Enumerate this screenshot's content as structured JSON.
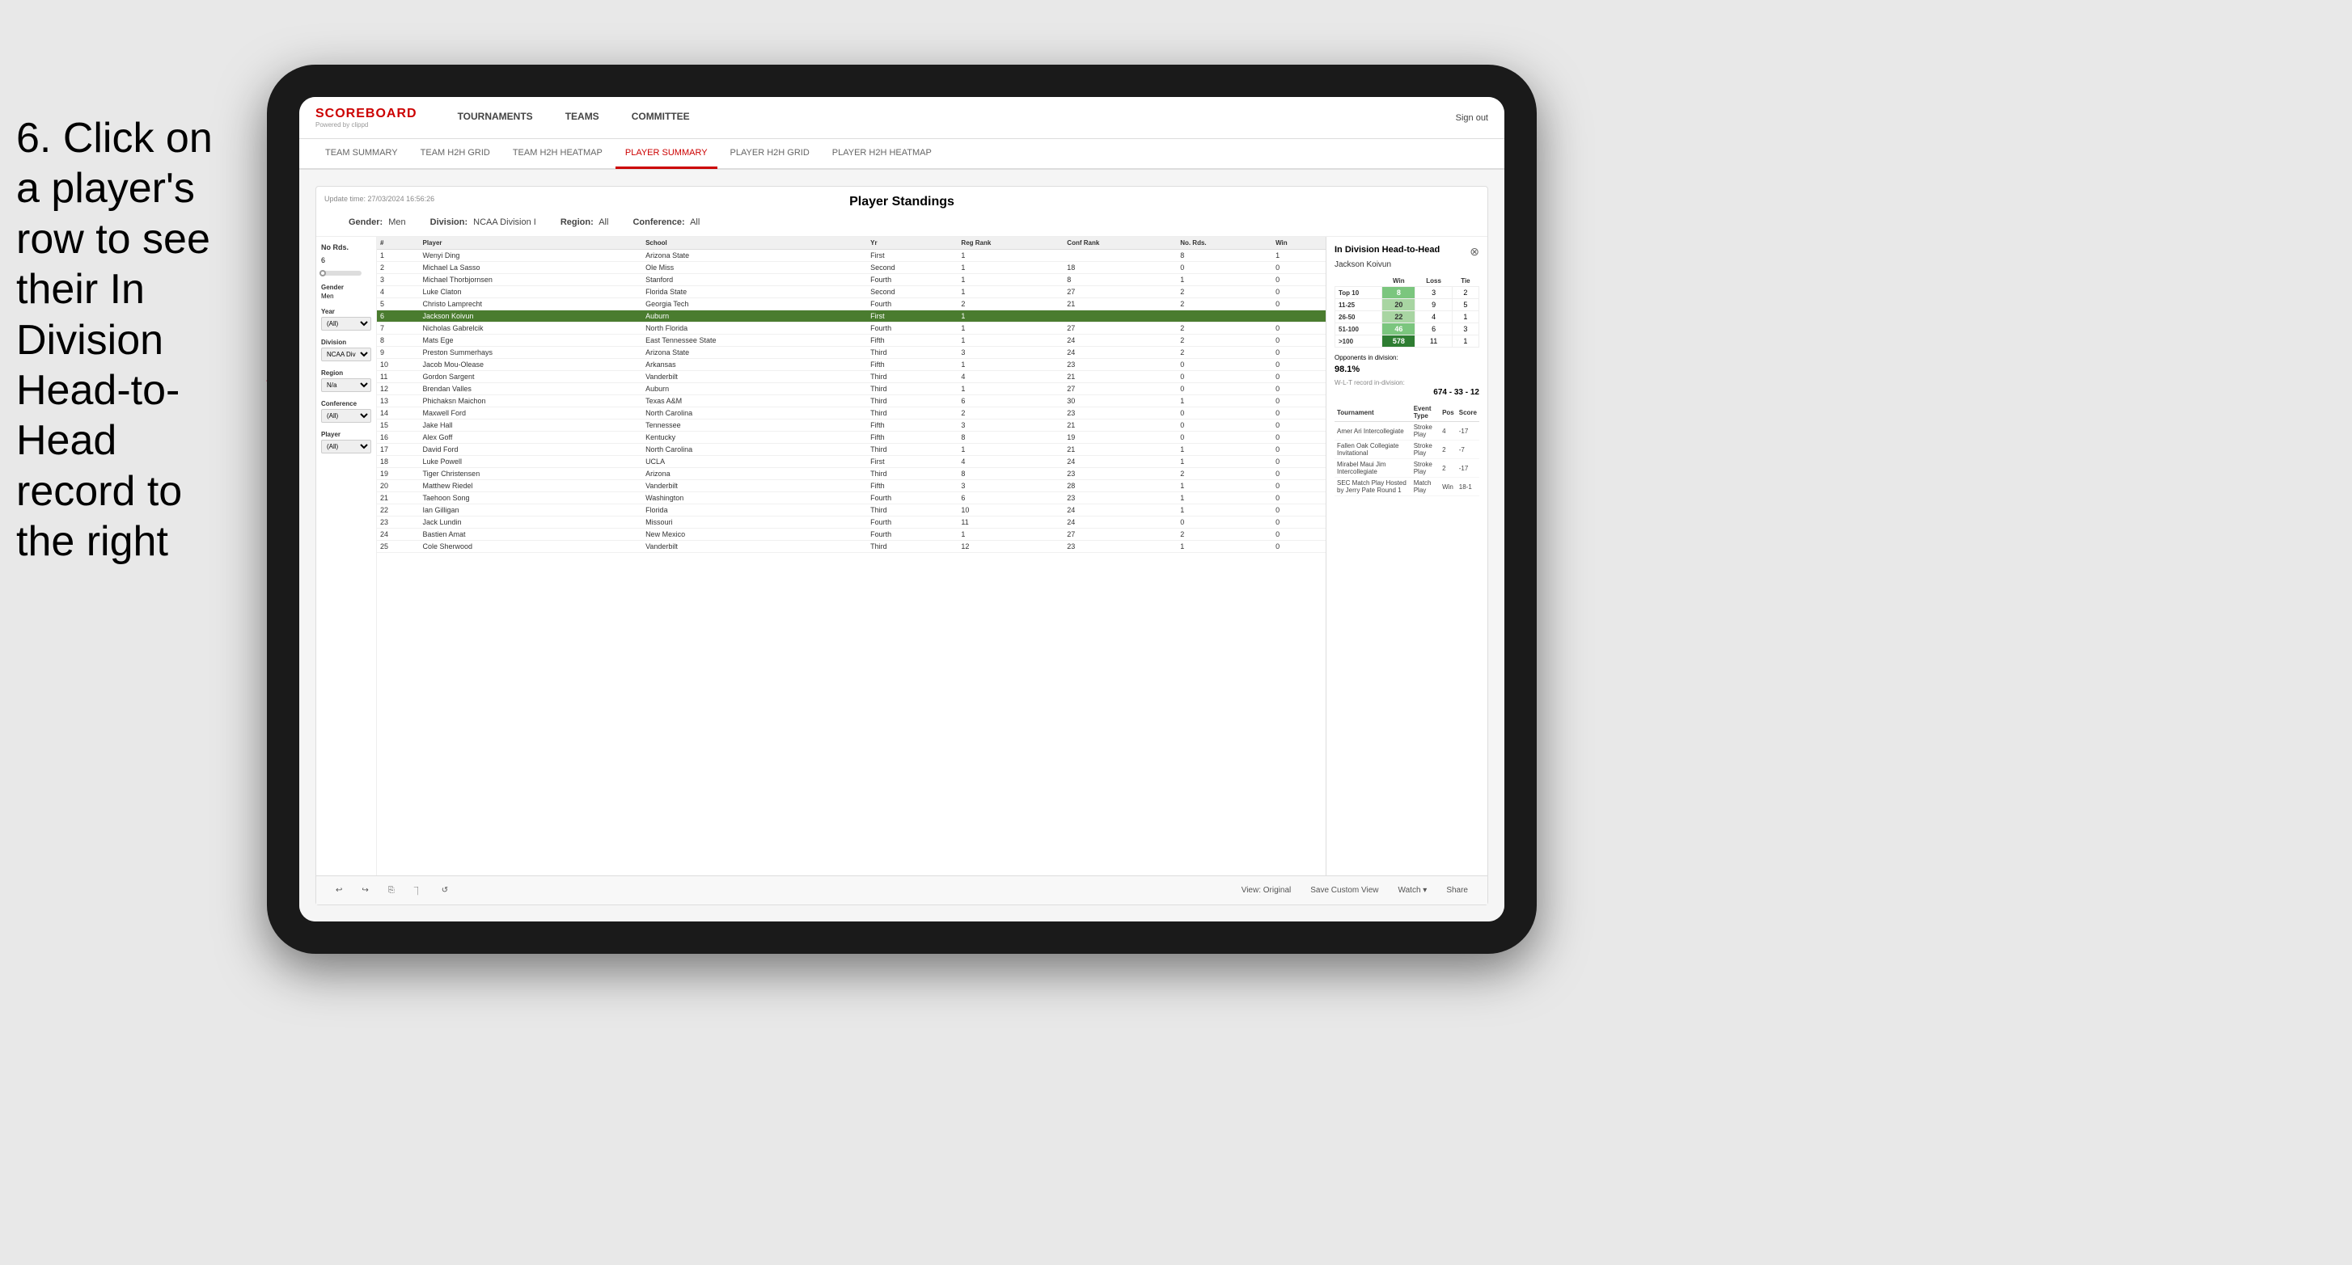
{
  "instruction": {
    "text": "6. Click on a player's row to see their In Division Head-to-Head record to the right"
  },
  "logo": {
    "main": "SCOREBOARD",
    "sub": "Powered by clippd"
  },
  "nav": {
    "links": [
      "TOURNAMENTS",
      "TEAMS",
      "COMMITTEE"
    ],
    "signout": "Sign out"
  },
  "subnav": {
    "links": [
      "TEAM SUMMARY",
      "TEAM H2H GRID",
      "TEAM H2H HEATMAP",
      "PLAYER SUMMARY",
      "PLAYER H2H GRID",
      "PLAYER H2H HEATMAP"
    ],
    "active": "PLAYER SUMMARY"
  },
  "dashboard": {
    "title": "Player Standings",
    "update_time": "Update time: 27/03/2024 16:56:26",
    "filters": {
      "gender_label": "Gender:",
      "gender_value": "Men",
      "division_label": "Division:",
      "division_value": "NCAA Division I",
      "region_label": "Region:",
      "region_value": "All",
      "conference_label": "Conference:",
      "conference_value": "All"
    }
  },
  "sidebar": {
    "rounds_label": "No Rds.",
    "rounds_value": "6",
    "gender_label": "Gender",
    "gender_value": "Men",
    "year_label": "Year",
    "year_value": "(All)",
    "division_label": "Division",
    "division_value": "NCAA Division I",
    "region_label": "Region",
    "region_value": "N/a",
    "conference_label": "Conference",
    "conference_value": "(All)",
    "player_label": "Player",
    "player_value": "(All)"
  },
  "table": {
    "headers": [
      "#",
      "Player",
      "School",
      "Yr",
      "Reg Rank",
      "Conf Rank",
      "No. Rds.",
      "Win"
    ],
    "rows": [
      {
        "num": 1,
        "player": "Wenyi Ding",
        "school": "Arizona State",
        "yr": "First",
        "reg": 1,
        "conf": "",
        "rds": 8,
        "win": 1
      },
      {
        "num": 2,
        "player": "Michael La Sasso",
        "school": "Ole Miss",
        "yr": "Second",
        "reg": 1,
        "conf": 18,
        "rds": 0,
        "win": 0
      },
      {
        "num": 3,
        "player": "Michael Thorbjornsen",
        "school": "Stanford",
        "yr": "Fourth",
        "reg": 1,
        "conf": 8,
        "rds": 1,
        "win": 0
      },
      {
        "num": 4,
        "player": "Luke Claton",
        "school": "Florida State",
        "yr": "Second",
        "reg": 1,
        "conf": 27,
        "rds": 2,
        "win": 0
      },
      {
        "num": 5,
        "player": "Christo Lamprecht",
        "school": "Georgia Tech",
        "yr": "Fourth",
        "reg": 2,
        "conf": 21,
        "rds": 2,
        "win": 0
      },
      {
        "num": 6,
        "player": "Jackson Koivun",
        "school": "Auburn",
        "yr": "First",
        "reg": 1,
        "conf": "",
        "rds": "",
        "win": ""
      },
      {
        "num": 7,
        "player": "Nicholas Gabrelcik",
        "school": "North Florida",
        "yr": "Fourth",
        "reg": 1,
        "conf": 27,
        "rds": 2,
        "win": 0
      },
      {
        "num": 8,
        "player": "Mats Ege",
        "school": "East Tennessee State",
        "yr": "Fifth",
        "reg": 1,
        "conf": 24,
        "rds": 2,
        "win": 0
      },
      {
        "num": 9,
        "player": "Preston Summerhays",
        "school": "Arizona State",
        "yr": "Third",
        "reg": 3,
        "conf": 24,
        "rds": 2,
        "win": 0
      },
      {
        "num": 10,
        "player": "Jacob Mou-Olease",
        "school": "Arkansas",
        "yr": "Fifth",
        "reg": 1,
        "conf": 23,
        "rds": 0,
        "win": 0
      },
      {
        "num": 11,
        "player": "Gordon Sargent",
        "school": "Vanderbilt",
        "yr": "Third",
        "reg": 4,
        "conf": 21,
        "rds": 0,
        "win": 0
      },
      {
        "num": 12,
        "player": "Brendan Valles",
        "school": "Auburn",
        "yr": "Third",
        "reg": 1,
        "conf": 27,
        "rds": 0,
        "win": 0
      },
      {
        "num": 13,
        "player": "Phichaksn Maichon",
        "school": "Texas A&M",
        "yr": "Third",
        "reg": 6,
        "conf": 30,
        "rds": 1,
        "win": 0
      },
      {
        "num": 14,
        "player": "Maxwell Ford",
        "school": "North Carolina",
        "yr": "Third",
        "reg": 2,
        "conf": 23,
        "rds": 0,
        "win": 0
      },
      {
        "num": 15,
        "player": "Jake Hall",
        "school": "Tennessee",
        "yr": "Fifth",
        "reg": 3,
        "conf": 21,
        "rds": 0,
        "win": 0
      },
      {
        "num": 16,
        "player": "Alex Goff",
        "school": "Kentucky",
        "yr": "Fifth",
        "reg": 8,
        "conf": 19,
        "rds": 0,
        "win": 0
      },
      {
        "num": 17,
        "player": "David Ford",
        "school": "North Carolina",
        "yr": "Third",
        "reg": 1,
        "conf": 21,
        "rds": 1,
        "win": 0
      },
      {
        "num": 18,
        "player": "Luke Powell",
        "school": "UCLA",
        "yr": "First",
        "reg": 4,
        "conf": 24,
        "rds": 1,
        "win": 0
      },
      {
        "num": 19,
        "player": "Tiger Christensen",
        "school": "Arizona",
        "yr": "Third",
        "reg": 8,
        "conf": 23,
        "rds": 2,
        "win": 0
      },
      {
        "num": 20,
        "player": "Matthew Riedel",
        "school": "Vanderbilt",
        "yr": "Fifth",
        "reg": 3,
        "conf": 28,
        "rds": 1,
        "win": 0
      },
      {
        "num": 21,
        "player": "Taehoon Song",
        "school": "Washington",
        "yr": "Fourth",
        "reg": 6,
        "conf": 23,
        "rds": 1,
        "win": 0
      },
      {
        "num": 22,
        "player": "Ian Gilligan",
        "school": "Florida",
        "yr": "Third",
        "reg": 10,
        "conf": 24,
        "rds": 1,
        "win": 0
      },
      {
        "num": 23,
        "player": "Jack Lundin",
        "school": "Missouri",
        "yr": "Fourth",
        "reg": 11,
        "conf": 24,
        "rds": 0,
        "win": 0
      },
      {
        "num": 24,
        "player": "Bastien Amat",
        "school": "New Mexico",
        "yr": "Fourth",
        "reg": 1,
        "conf": 27,
        "rds": 2,
        "win": 0
      },
      {
        "num": 25,
        "player": "Cole Sherwood",
        "school": "Vanderbilt",
        "yr": "Third",
        "reg": 12,
        "conf": 23,
        "rds": 1,
        "win": 0
      }
    ]
  },
  "h2h_panel": {
    "title": "In Division Head-to-Head",
    "player_name": "Jackson Koivun",
    "table_headers": [
      "",
      "Win",
      "Loss",
      "Tie"
    ],
    "rows": [
      {
        "label": "Top 10",
        "win": 8,
        "loss": 3,
        "tie": 2,
        "win_class": "green-cell"
      },
      {
        "label": "11-25",
        "win": 20,
        "loss": 9,
        "tie": 5,
        "win_class": "light-green-cell"
      },
      {
        "label": "26-50",
        "win": 22,
        "loss": 4,
        "tie": 1,
        "win_class": "light-green-cell"
      },
      {
        "label": "51-100",
        "win": 46,
        "loss": 6,
        "tie": 3,
        "win_class": "green-cell"
      },
      {
        "label": ">100",
        "win": 578,
        "loss": 11,
        "tie": 1,
        "win_class": "very-green-cell"
      }
    ],
    "opponents_label": "Opponents in division:",
    "opponents_value": "98.1%",
    "wlt_label": "W-L-T record in-division:",
    "wlt_value": "674 - 33 - 12",
    "tournament_headers": [
      "Tournament",
      "Event Type",
      "Pos",
      "Score"
    ],
    "tournaments": [
      {
        "name": "Amer Ari Intercollegiate",
        "type": "Stroke Play",
        "pos": 4,
        "score": -17
      },
      {
        "name": "Fallen Oak Collegiate Invitational",
        "type": "Stroke Play",
        "pos": 2,
        "score": -7
      },
      {
        "name": "Mirabel Maui Jim Intercollegiate",
        "type": "Stroke Play",
        "pos": 2,
        "score": -17
      },
      {
        "name": "SEC Match Play Hosted by Jerry Pate Round 1",
        "type": "Match Play",
        "pos": "Win",
        "score": "18-1"
      }
    ]
  },
  "toolbar": {
    "view_original": "View: Original",
    "save_custom": "Save Custom View",
    "watch": "Watch ▾",
    "share": "Share"
  }
}
